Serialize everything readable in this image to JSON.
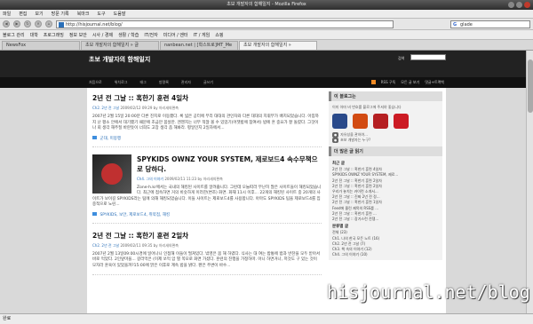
{
  "window": {
    "title": "초보 개발자의 함해일지 - Mozilla Firefox"
  },
  "menubar": [
    "파일",
    "편집",
    "보기",
    "방문 기록",
    "북마크",
    "도구",
    "도움말"
  ],
  "navbar": {
    "url": "http://hisjournal.net/blog/",
    "search_value": "glade"
  },
  "bookmarks": [
    "블로그 관리",
    "대학",
    "프로그래밍",
    "정보 보안",
    "시사 / 경제",
    "생활 / 학습",
    "IT/전자",
    "미디어 / 엔터",
    "IT / 게임",
    "쇼핑"
  ],
  "tabs": [
    {
      "label": "NewsFox"
    },
    {
      "label": "초보 개발자의 함해일지 » 글"
    },
    {
      "label": "nanbean.net | [학스트로]MT_Me"
    },
    {
      "label": "초보 개발자의 함해일지 »"
    }
  ],
  "blog": {
    "title": "초보 개발자의 함해일지",
    "search_label": "검색",
    "nav": [
      "처음으로",
      "위치로그",
      "태그",
      "방명록",
      "관리자",
      "글쓰기"
    ],
    "rss": [
      "RSS 구독",
      "모든 글 보기",
      "댓글+트랙백"
    ]
  },
  "posts": [
    {
      "title": "2년 전 그날 :: 혹한기 훈련 4일차",
      "meta_cat": "Ch2. 2년 전 그날",
      "meta_date": "2009/02/12 09:29",
      "meta_author": "by 아리새의편측",
      "body": "2007년 2월 15일 20:00분 다른 진지로 이동했다. 록 넓은 공터에 무리 대대의 관인차와 다른 대대의 지휘부가 배치되었습니다. 아침까지 난 평소 안에서 대기했기 때문에 조금만 몸살만. 엔젠지는 너무 적잖 볼 수 있었기(어젯밤에 참여서) 밤에 흔 중요가 잘 돌렸다. 그것이 나 회 생각 해주질 바란듯이 너희도 고장 생각 좀 해봐라. 평일인지 2일차에서...",
      "tags": "군대, 미몽행"
    },
    {
      "title": "SPYKIDS OWNZ YOUR SYSTEM, 제로보드4 속수무책으로 당하다.",
      "meta_cat": "Ch4. 그의 이야기",
      "meta_date": "2009/02/11 11:23",
      "meta_author": "by 아리새의편측",
      "body": "Zone-h.kr에서는 국내의 해킹된 사이트를 알려줍니다. 그런데 오늘따라 무난히 많은 사이트들이 해킹되었습니다. 최근에 접속하면 거의 비슷하게 이러한(변조) 화면. 화재 11시 이후... 22개의 해킹된 사이트 중 20개의 사이트가 보이길 SPYKIDS라는 팀에 의해 해킹되었습니다. 이들 사이트는 제로보드4를 사용합니다. 아마도 SPYKIDS 팀을 제로보드4를 집중적으로 노린...",
      "tags": "SPYKIDS, 보안, 제로보드4, 취약점, 해킹"
    },
    {
      "title": "2년 전 그날 :: 혹한기 훈련 2일차",
      "meta_cat": "Ch2. 2년 전 그날",
      "meta_date": "2009/02/11 09:35",
      "meta_author": "by 아리새의편측",
      "body": "2007년 2월 13일09:00시경에 일어나니 인접해 이들이 떨쳐있다. 밖영은 몸 해 하였다. 식사는 대 여는 밥통에 밥과 반찬을 모두 받아서 바로 먹었다. 2인앞마을... 갈라먹은 (이제 쏘먹 암 별 쪽모로 화면 가셨다. 훈련의 진행을 가정하마. 아니 하면거나, 저것도 구 있는 것이 모자라 훈육이 있었을까?15:00에 맑은 이후로 계속 밤을 밝다. 펜은 주변이 바수...",
      "tags": ""
    }
  ],
  "sidebar": {
    "about_head": "이 블로그는",
    "about_text": "이미 아마 비 번호를 블로그에 주셔야 좋습니다",
    "notice_1": "자유성을 관하여...",
    "notice_2": "초보 개발자는 누구?",
    "recent_head": "더 많은 글 읽기",
    "recent_sub": "최근 글",
    "recent": [
      "2년 전 그날 :: 혹한기 훈련 4일차",
      "SPYKIDS OWNZ YOUR SYSTEM, 제로...",
      "2년 전 그날 :: 혹한기 훈련 2일차",
      "2년 전 그날 :: 혹한기 훈련 2일차",
      "우리가 놓치는 카이런 소개서...",
      "2년 전 그날 :: 진짜 2년 전 정...",
      "2년 전 그날 :: 혹한기 훈련 1일차",
      "Feed에 올린 제목의 RSS를 ...",
      "2년 전 그날 :: 혹한기 훈련 ...",
      "2년 전 그날 :: 장기스런 전쟁..."
    ],
    "cat_sub": "분류별 글",
    "categories": [
      "전체 (23)",
      "Ch1. 나의 한국 모든 노트 (16)",
      "Ch2. 2년 전 그날 (7)",
      "Ch3. 책 속의 이야기 (12)",
      "Ch4. 그의 이야기 (10)"
    ]
  },
  "statusbar": {
    "text": "완료"
  },
  "watermark": {
    "text": "hisjournal.net/blog"
  }
}
